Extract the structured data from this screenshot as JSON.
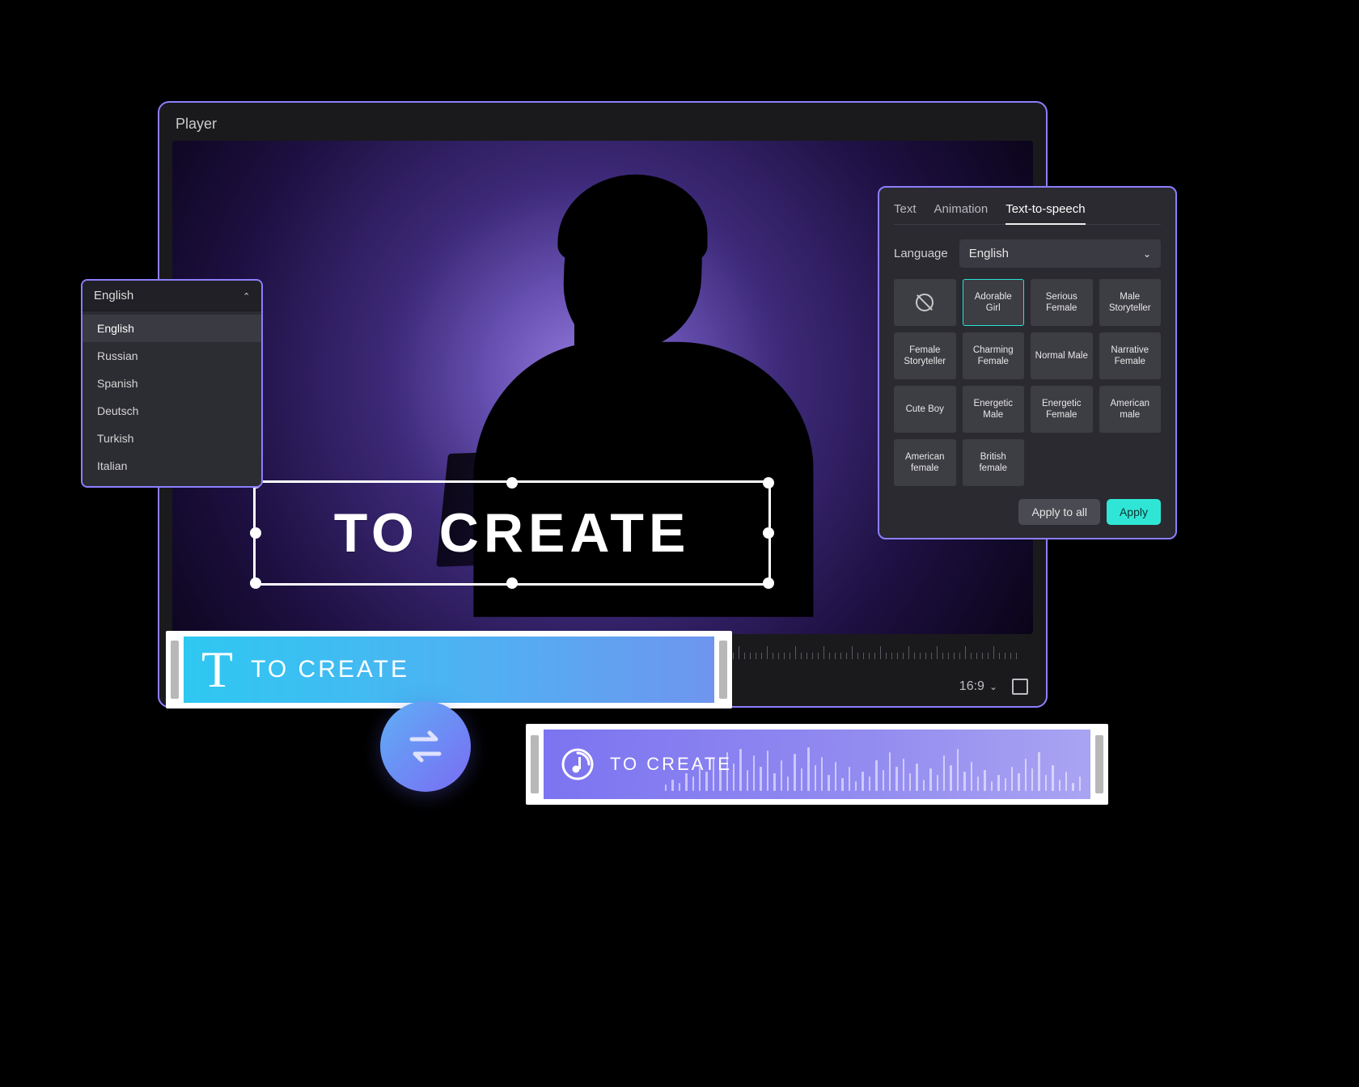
{
  "player": {
    "title": "Player",
    "caption_text": "TO CREATE",
    "aspect_ratio": "16:9"
  },
  "language_dropdown": {
    "selected": "English",
    "options": [
      "English",
      "Russian",
      "Spanish",
      "Deutsch",
      "Turkish",
      "Italian"
    ]
  },
  "tts_panel": {
    "tabs": [
      "Text",
      "Animation",
      "Text-to-speech"
    ],
    "active_tab": "Text-to-speech",
    "language_label": "Language",
    "language_value": "English",
    "voices": [
      {
        "label": null,
        "none": true
      },
      {
        "label": "Adorable Girl",
        "selected": true
      },
      {
        "label": "Serious Female"
      },
      {
        "label": "Male Storyteller"
      },
      {
        "label": "Female Storyteller"
      },
      {
        "label": "Charming Female"
      },
      {
        "label": "Normal Male"
      },
      {
        "label": "Narrative Female"
      },
      {
        "label": "Cute Boy"
      },
      {
        "label": "Energetic Male"
      },
      {
        "label": "Energetic Female"
      },
      {
        "label": "American male"
      },
      {
        "label": "American female"
      },
      {
        "label": "British female"
      }
    ],
    "apply_all_label": "Apply to all",
    "apply_label": "Apply"
  },
  "text_clip": {
    "icon_letter": "T",
    "label": "TO CREATE"
  },
  "audio_clip": {
    "label": "TO CREATE"
  },
  "colors": {
    "accent_border": "#8c7fff",
    "accent_cyan": "#2fe6d6"
  }
}
